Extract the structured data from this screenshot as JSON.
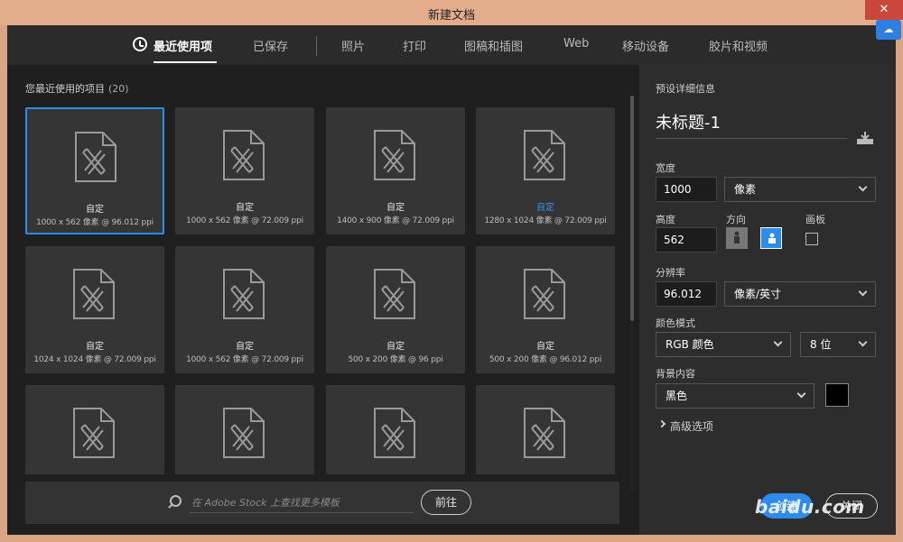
{
  "window": {
    "title": "新建文档"
  },
  "tabs": [
    {
      "label": "最近使用项"
    },
    {
      "label": "已保存"
    },
    {
      "label": "照片"
    },
    {
      "label": "打印"
    },
    {
      "label": "图稿和插图"
    },
    {
      "label": "Web"
    },
    {
      "label": "移动设备"
    },
    {
      "label": "胶片和视频"
    }
  ],
  "recent": {
    "title": "您最近使用的项目",
    "count": "(20)",
    "items": [
      {
        "name": "自定",
        "dims": "1000 x 562 像素 @ 96.012 ppi"
      },
      {
        "name": "自定",
        "dims": "1000 x 562 像素 @ 72.009 ppi"
      },
      {
        "name": "自定",
        "dims": "1400 x 900 像素 @ 72.009 ppi"
      },
      {
        "name": "自定",
        "dims": "1280 x 1024 像素 @ 72.009 ppi"
      },
      {
        "name": "自定",
        "dims": "1024 x 1024 像素 @ 72.009 ppi"
      },
      {
        "name": "自定",
        "dims": "1000 x 562 像素 @ 72.009 ppi"
      },
      {
        "name": "自定",
        "dims": "500 x 200 像素 @ 96 ppi"
      },
      {
        "name": "自定",
        "dims": "500 x 200 像素 @ 96.012 ppi"
      },
      {
        "name": "",
        "dims": ""
      },
      {
        "name": "",
        "dims": ""
      },
      {
        "name": "",
        "dims": ""
      },
      {
        "name": "",
        "dims": ""
      }
    ]
  },
  "stock": {
    "placeholder": "在 Adobe Stock 上查找更多模板",
    "go_label": "前往"
  },
  "preset": {
    "header": "预设详细信息",
    "name": "未标题-1",
    "width_label": "宽度",
    "width_value": "1000",
    "unit": "像素",
    "height_label": "高度",
    "height_value": "562",
    "orientation_label": "方向",
    "artboard_label": "画板",
    "resolution_label": "分辨率",
    "resolution_value": "96.012",
    "resolution_unit": "像素/英寸",
    "color_mode_label": "颜色模式",
    "color_mode": "RGB 颜色",
    "bit_depth": "8 位",
    "background_label": "背景内容",
    "background": "黑色",
    "background_color": "#000000",
    "advanced_label": "高级选项",
    "create_label": "创建",
    "close_label": "关闭"
  },
  "watermark": "baidu.com"
}
